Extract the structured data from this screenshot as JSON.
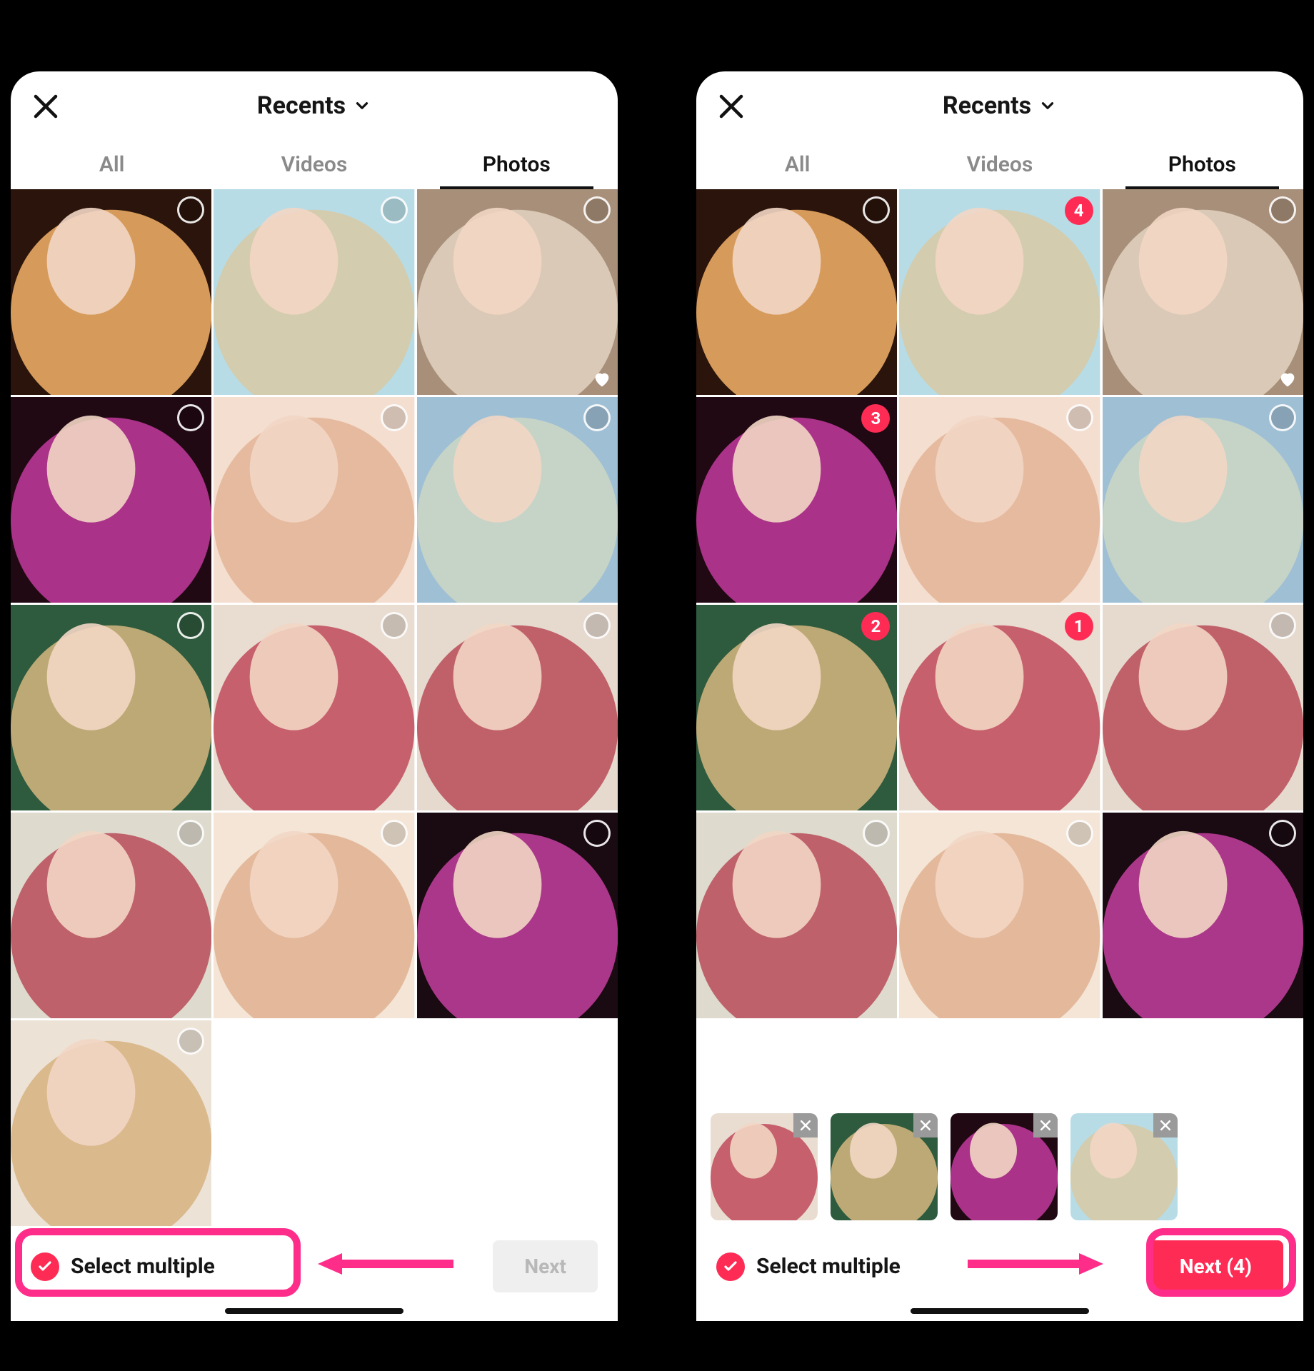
{
  "colors": {
    "accent": "#fe2c55",
    "highlight": "#ff2d8a"
  },
  "left": {
    "title": "Recents",
    "tabs": [
      "All",
      "Videos",
      "Photos"
    ],
    "activeTab": "Photos",
    "selectMultiple": "Select multiple",
    "nextLabel": "Next",
    "selectedCount": 0,
    "photos": [
      {
        "bg": [
          "#2a140b",
          "#f5b36a"
        ],
        "selected": null,
        "hearted": false
      },
      {
        "bg": [
          "#b7dce6",
          "#d8c9a3"
        ],
        "selected": null,
        "hearted": false
      },
      {
        "bg": [
          "#a78f7a",
          "#e3d4c1"
        ],
        "selected": null,
        "hearted": true
      },
      {
        "bg": [
          "#210914",
          "#c23a9e"
        ],
        "selected": null,
        "hearted": false
      },
      {
        "bg": [
          "#f4ded0",
          "#e3b497"
        ],
        "selected": null,
        "hearted": false
      },
      {
        "bg": [
          "#9fbfd4",
          "#cdd7c4"
        ],
        "selected": null,
        "hearted": false
      },
      {
        "bg": [
          "#2e5a3d",
          "#d6b780"
        ],
        "selected": null,
        "hearted": false
      },
      {
        "bg": [
          "#e9dcd1",
          "#c04a5a"
        ],
        "selected": null,
        "hearted": false
      },
      {
        "bg": [
          "#e6dacf",
          "#b94b58"
        ],
        "selected": null,
        "hearted": false
      },
      {
        "bg": [
          "#dedacd",
          "#b94b58"
        ],
        "selected": null,
        "hearted": false
      },
      {
        "bg": [
          "#f4e5d6",
          "#e1b190"
        ],
        "selected": null,
        "hearted": false
      },
      {
        "bg": [
          "#1a0a12",
          "#c53fa0"
        ],
        "selected": null,
        "hearted": false
      },
      {
        "bg": [
          "#ece2d5",
          "#d7b280"
        ],
        "selected": null,
        "hearted": false
      }
    ]
  },
  "right": {
    "title": "Recents",
    "tabs": [
      "All",
      "Videos",
      "Photos"
    ],
    "activeTab": "Photos",
    "selectMultiple": "Select multiple",
    "nextLabel": "Next (4)",
    "selectedCount": 4,
    "photos": [
      {
        "bg": [
          "#2a140b",
          "#f5b36a"
        ],
        "selected": null,
        "hearted": false
      },
      {
        "bg": [
          "#b7dce6",
          "#d8c9a3"
        ],
        "selected": 4,
        "hearted": false
      },
      {
        "bg": [
          "#a78f7a",
          "#e3d4c1"
        ],
        "selected": null,
        "hearted": true
      },
      {
        "bg": [
          "#210914",
          "#c23a9e"
        ],
        "selected": 3,
        "hearted": false
      },
      {
        "bg": [
          "#f4ded0",
          "#e3b497"
        ],
        "selected": null,
        "hearted": false
      },
      {
        "bg": [
          "#9fbfd4",
          "#cdd7c4"
        ],
        "selected": null,
        "hearted": false
      },
      {
        "bg": [
          "#2e5a3d",
          "#d6b780"
        ],
        "selected": 2,
        "hearted": false
      },
      {
        "bg": [
          "#e9dcd1",
          "#c04a5a"
        ],
        "selected": 1,
        "hearted": false
      },
      {
        "bg": [
          "#e6dacf",
          "#b94b58"
        ],
        "selected": null,
        "hearted": false
      },
      {
        "bg": [
          "#dedacd",
          "#b94b58"
        ],
        "selected": null,
        "hearted": false
      },
      {
        "bg": [
          "#f4e5d6",
          "#e1b190"
        ],
        "selected": null,
        "hearted": false
      },
      {
        "bg": [
          "#1a0a12",
          "#c53fa0"
        ],
        "selected": null,
        "hearted": false
      }
    ],
    "tray": [
      {
        "bg": [
          "#e9dcd1",
          "#c04a5a"
        ]
      },
      {
        "bg": [
          "#2e5a3d",
          "#d6b780"
        ]
      },
      {
        "bg": [
          "#210914",
          "#c23a9e"
        ]
      },
      {
        "bg": [
          "#b7dce6",
          "#d8c9a3"
        ]
      }
    ]
  }
}
